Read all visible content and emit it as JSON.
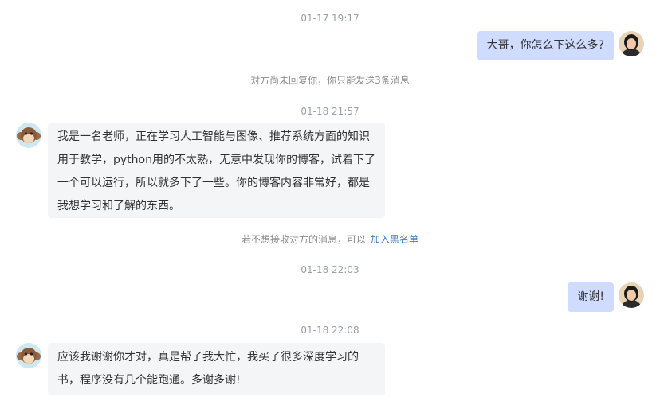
{
  "chat": {
    "messages": [
      {
        "timestamp": "01-17 19:17",
        "sender": "me",
        "text": "大哥，你怎么下这么多?"
      },
      {
        "notice": "对方尚未回复你，你只能发送3条消息"
      },
      {
        "timestamp": "01-18 21:57",
        "sender": "other",
        "text": "我是一名老师，正在学习人工智能与图像、推荐系统方面的知识用于教学，python用的不太熟，无意中发现你的博客，试着下了一个可以运行，所以就多下了一些。你的博客内容非常好，都是我想学习和了解的东西。"
      },
      {
        "notice": "若不想接收对方的消息，可以",
        "link": "加入黑名单"
      },
      {
        "timestamp": "01-18 22:03",
        "sender": "me",
        "text": "谢谢!"
      },
      {
        "timestamp": "01-18 22:08",
        "sender": "other",
        "text": "应该我谢谢你才对，真是帮了我大忙，我买了很多深度学习的书，程序没有几个能跑通。多谢多谢!"
      }
    ]
  },
  "colors": {
    "my_bubble": "#cfdcff",
    "their_bubble": "#f3f5f7",
    "link": "#3d7fc1"
  }
}
